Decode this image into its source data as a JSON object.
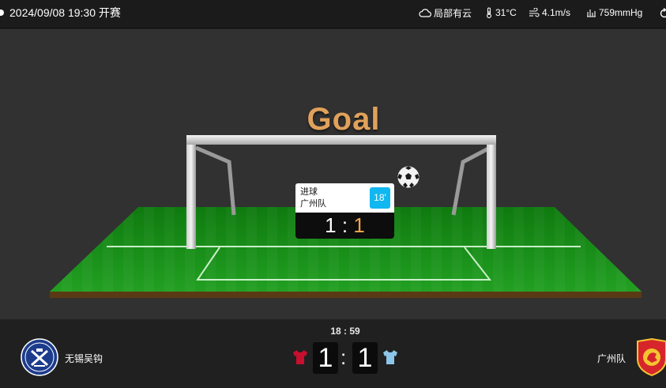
{
  "header": {
    "datetime": "2024/09/08 19:30",
    "status": "开赛",
    "weather": {
      "condition": "局部有云",
      "condition_icon": "cloud-icon",
      "temperature": "31°C",
      "temperature_icon": "thermometer-icon",
      "wind": "4.1m/s",
      "wind_icon": "wind-icon",
      "pressure": "759mmHg",
      "pressure_icon": "pressure-icon"
    }
  },
  "animation": {
    "title": "Goal",
    "event": {
      "type": "进球",
      "team": "广州队",
      "minute": "18'",
      "home_score": "1",
      "away_score": "1",
      "separator": ":"
    }
  },
  "scoreboard": {
    "clock": "18 : 59",
    "home": {
      "name": "无锡吴钩",
      "score": "1",
      "shirt_color": "#c8102e"
    },
    "away": {
      "name": "广州队",
      "score": "1",
      "shirt_color": "#8cc6ea"
    },
    "separator": ":"
  },
  "colors": {
    "accent_orange": "#e0a15a",
    "minute_badge": "#10b7f0",
    "pitch_green": "#1c8a1c"
  }
}
